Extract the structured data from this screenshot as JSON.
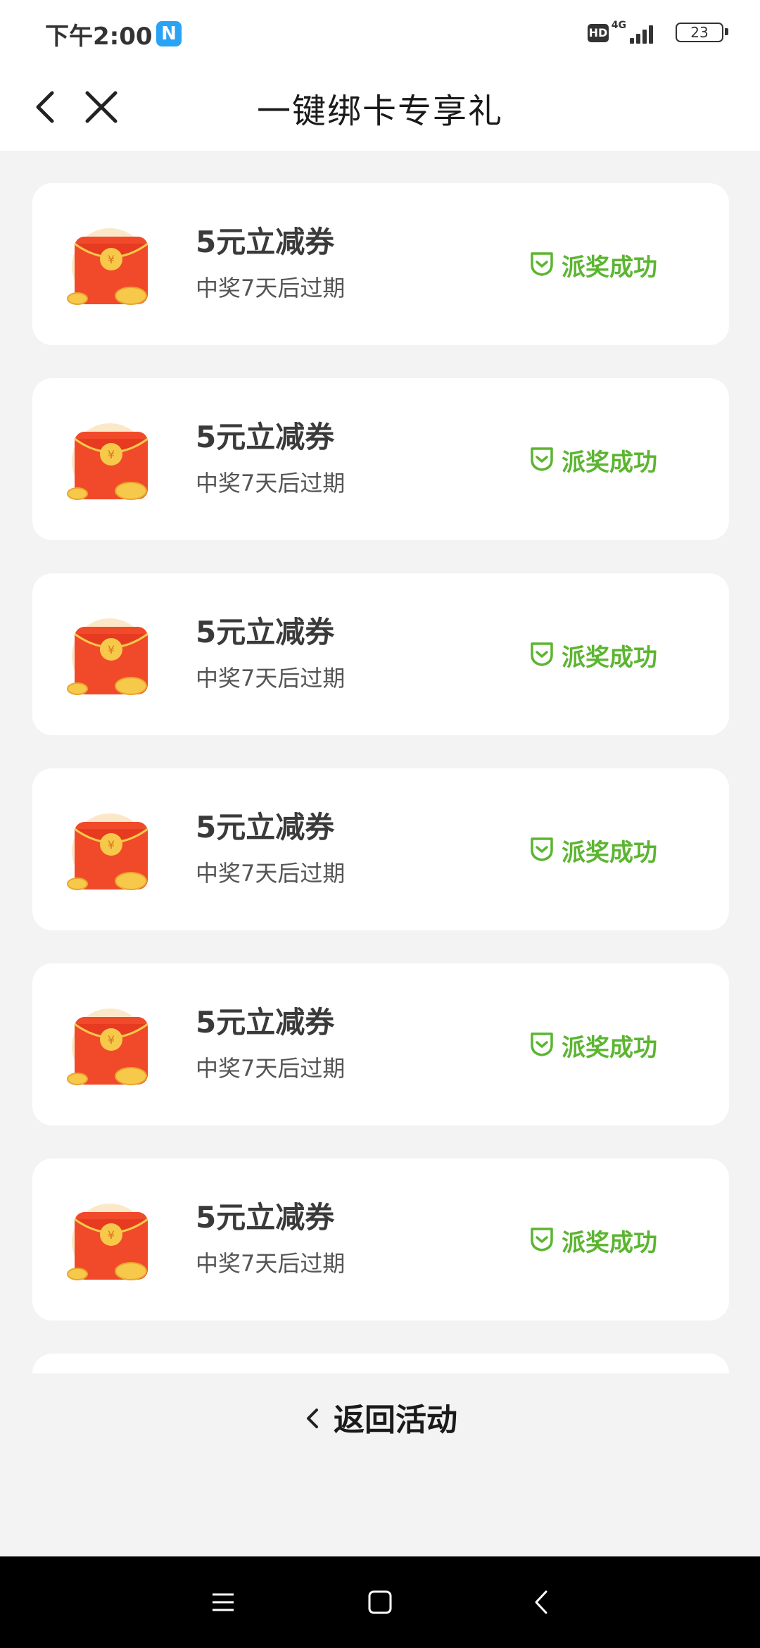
{
  "status_bar": {
    "time": "下午2:00",
    "app_badge": "N",
    "hd": "HD",
    "network": "4G",
    "battery": "23"
  },
  "header": {
    "title": "一键绑卡专享礼",
    "back_icon": "chevron-left-icon",
    "close_icon": "close-icon"
  },
  "coupons": [
    {
      "title": "5元立减券",
      "subtitle": "中奖7天后过期",
      "status": "派奖成功"
    },
    {
      "title": "5元立减券",
      "subtitle": "中奖7天后过期",
      "status": "派奖成功"
    },
    {
      "title": "5元立减券",
      "subtitle": "中奖7天后过期",
      "status": "派奖成功"
    },
    {
      "title": "5元立减券",
      "subtitle": "中奖7天后过期",
      "status": "派奖成功"
    },
    {
      "title": "5元立减券",
      "subtitle": "中奖7天后过期",
      "status": "派奖成功"
    },
    {
      "title": "5元立减券",
      "subtitle": "中奖7天后过期",
      "status": "派奖成功"
    }
  ],
  "return_link": {
    "label": "返回活动"
  },
  "colors": {
    "accent_green": "#5cb531",
    "envelope_red": "#f04a2a",
    "coin_gold": "#f7c94a"
  },
  "nav_bar": {
    "menu_icon": "menu-icon",
    "home_icon": "home-icon",
    "back_icon": "back-icon"
  }
}
